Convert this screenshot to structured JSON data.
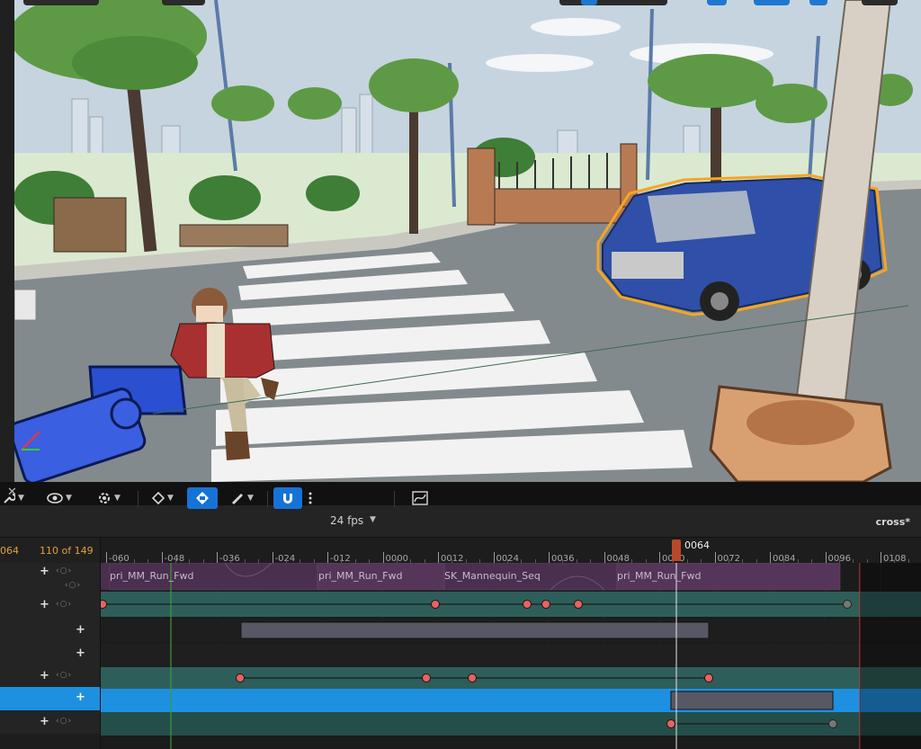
{
  "viewport": {
    "colors": {
      "sky": "#b9c9d6",
      "road": "#7f8588",
      "grass": "#d9e8cf",
      "van": "#2f4fa8",
      "selection": "#f5a623"
    }
  },
  "toolbar": {
    "transform_icon": "wrench-icon",
    "view_icon": "eye-icon",
    "actor_icon": "actor-settings-icon",
    "key_icon": "diamond-key-icon",
    "auto_key_icon": "auto-key-icon",
    "edit_icon": "pencil-icon",
    "snap_icon": "magnet-icon",
    "more_icon": "vertical-dots-icon",
    "fps_label": "24 fps",
    "curve_icon": "curve-editor-icon",
    "sequence_name": "cross*"
  },
  "frame_info": {
    "current": "064",
    "count": "110 of 149"
  },
  "ruler": {
    "labels": [
      "-060",
      "-048",
      "-036",
      "-024",
      "-012",
      "0000",
      "0012",
      "0024",
      "0036",
      "0048",
      "0060",
      "0072",
      "0084",
      "0096",
      "0108"
    ],
    "playhead": "0064"
  },
  "sections": [
    {
      "label": "pri_MM_Run_Fwd"
    },
    {
      "label": "pri_MM_Run_Fwd"
    },
    {
      "label": "SK_Mannequin_Seq"
    },
    {
      "label": "pri_MM_Run_Fwd"
    }
  ],
  "colors": {
    "anim_track": "#4a2f4e",
    "teal_track": "#2e5e5a",
    "selected_track": "#1e90e0",
    "key": "#e46464",
    "section_bar": "#585864",
    "playhead": "#b8482a",
    "accent": "#1673d6"
  }
}
